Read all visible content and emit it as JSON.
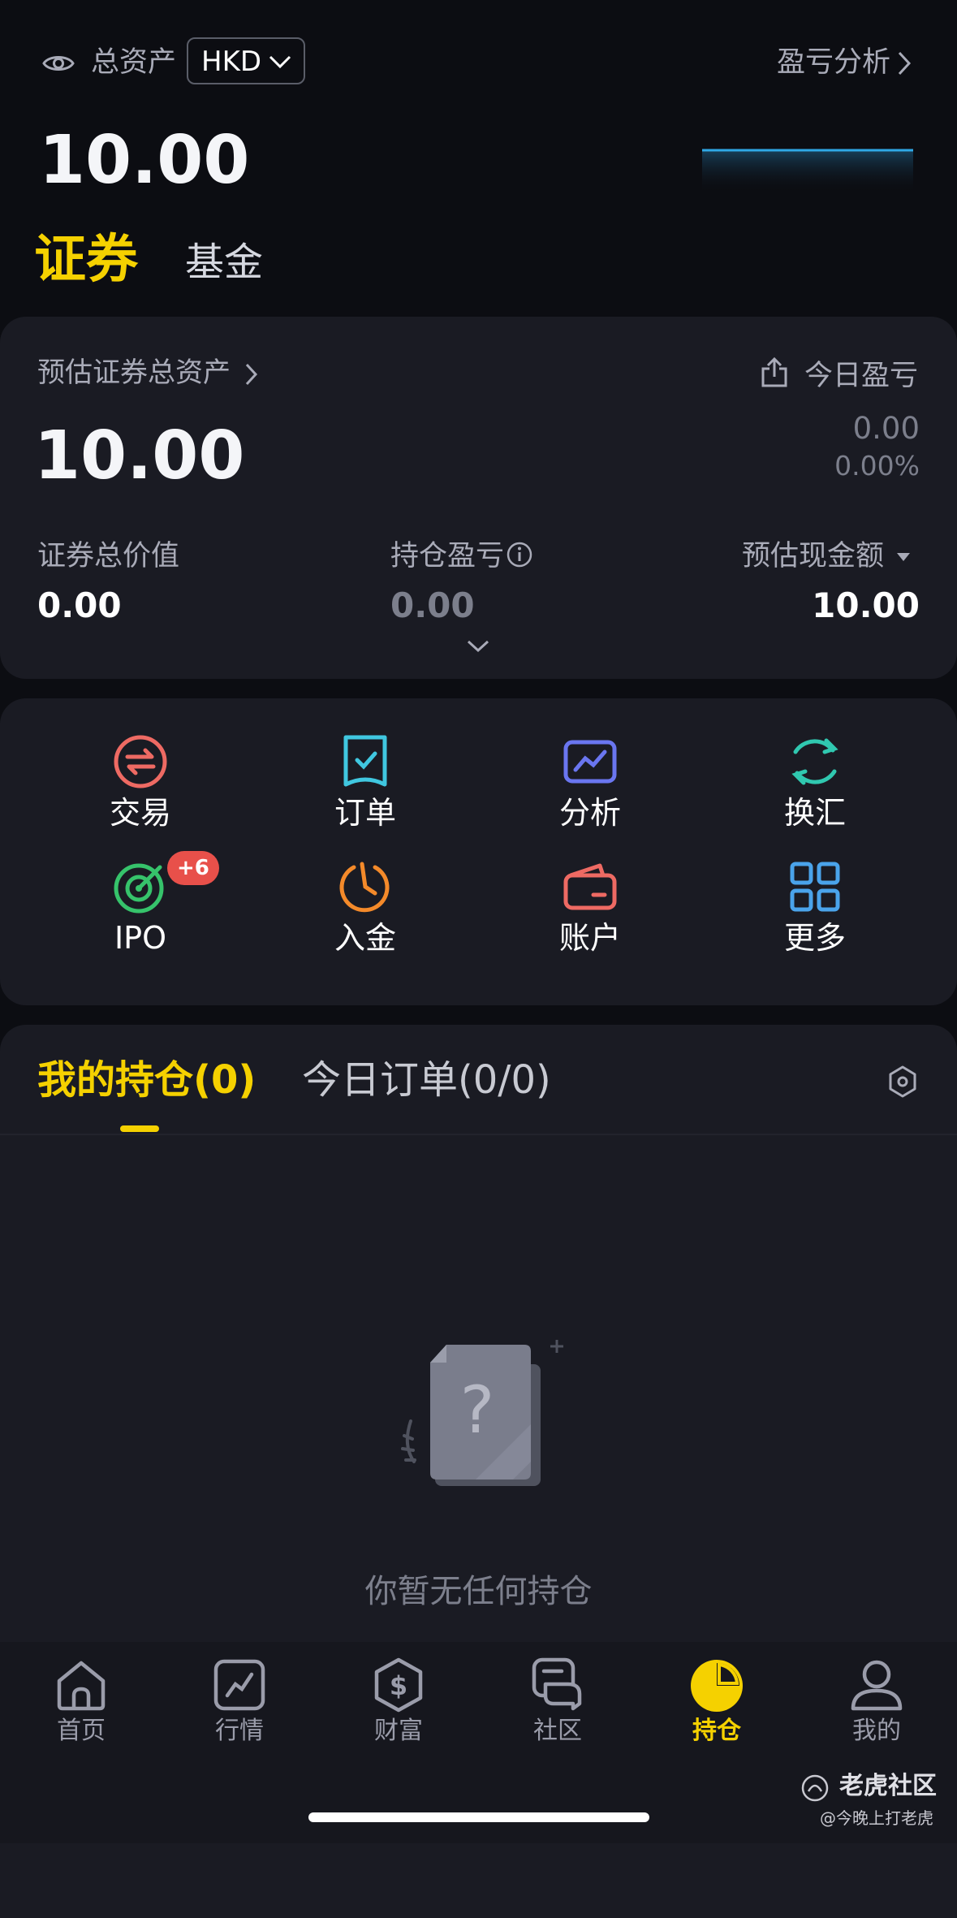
{
  "header": {
    "total_assets_label": "总资产",
    "currency": "HKD",
    "pnl_analysis": "盈亏分析",
    "total_value": "10.00"
  },
  "asset_tabs": [
    "证券",
    "基金"
  ],
  "summary": {
    "est_total_label": "预估证券总资产",
    "today_pnl_label": "今日盈亏",
    "total": "10.00",
    "today_pnl": "0.00",
    "today_pnl_pct": "0.00%",
    "securities_value_label": "证券总价值",
    "securities_value": "0.00",
    "position_pnl_label": "持仓盈亏",
    "position_pnl": "0.00",
    "est_cash_label": "预估现金额",
    "est_cash": "10.00"
  },
  "actions": [
    {
      "label": "交易",
      "icon": "exchange-icon",
      "color": "#ee6a63"
    },
    {
      "label": "订单",
      "icon": "order-check-icon",
      "color": "#40c7e0"
    },
    {
      "label": "分析",
      "icon": "analysis-chart-icon",
      "color": "#6a76f0"
    },
    {
      "label": "换汇",
      "icon": "currency-swap-icon",
      "color": "#30c8b0"
    },
    {
      "label": "IPO",
      "icon": "target-icon",
      "color": "#36c36b",
      "badge": "+6"
    },
    {
      "label": "入金",
      "icon": "deposit-clock-icon",
      "color": "#f48a2a"
    },
    {
      "label": "账户",
      "icon": "wallet-icon",
      "color": "#ee6a63"
    },
    {
      "label": "更多",
      "icon": "grid-more-icon",
      "color": "#4aa3ea"
    }
  ],
  "positions": {
    "tab_holdings": "我的持仓(0)",
    "tab_orders": "今日订单(0/0)",
    "empty_text": "你暂无任何持仓"
  },
  "nav": [
    {
      "label": "首页",
      "icon": "home-icon"
    },
    {
      "label": "行情",
      "icon": "market-icon"
    },
    {
      "label": "财富",
      "icon": "wealth-icon"
    },
    {
      "label": "社区",
      "icon": "community-icon"
    },
    {
      "label": "持仓",
      "icon": "holdings-pie-icon",
      "active": true
    },
    {
      "label": "我的",
      "icon": "profile-icon"
    }
  ],
  "watermark": {
    "title": "老虎社区",
    "handle": "@今晚上打老虎"
  },
  "colors": {
    "accent": "#f5d100",
    "background": "#0c0d12",
    "card": "#1a1b23"
  }
}
